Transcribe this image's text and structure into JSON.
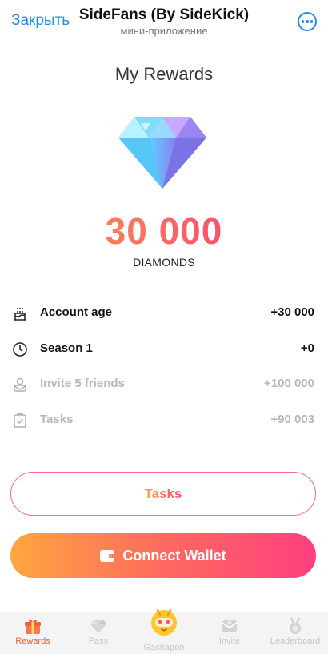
{
  "topbar": {
    "close_label": "Закрыть",
    "title": "SideFans (By SideKick)",
    "subtitle": "мини-приложение",
    "more_icon": "more-circle-icon"
  },
  "page": {
    "title": "My Rewards",
    "amount": "30 000",
    "amount_unit": "DIAMONDS"
  },
  "rewards": [
    {
      "icon": "cake-icon",
      "label": "Account age",
      "value": "+30 000",
      "state": "active"
    },
    {
      "icon": "clock-icon",
      "label": "Season 1",
      "value": "+0",
      "state": "active"
    },
    {
      "icon": "invite-icon",
      "label": "Invite 5 friends",
      "value": "+100 000",
      "state": "dimmed"
    },
    {
      "icon": "clipboard-check-icon",
      "label": "Tasks",
      "value": "+90 003",
      "state": "dimmed"
    }
  ],
  "buttons": {
    "tasks_label": "Tasks",
    "wallet_label": "Connect Wallet"
  },
  "tabbar": {
    "tabs": [
      {
        "icon": "gift-icon",
        "label": "Rewards",
        "active": true
      },
      {
        "icon": "diamond-tab-icon",
        "label": "Pass",
        "active": false
      },
      {
        "icon": "gachapon-icon",
        "label": "Gachapon",
        "active": false
      },
      {
        "icon": "invite-tab-icon",
        "label": "Invite",
        "active": false
      },
      {
        "icon": "medal-icon",
        "label": "Leaderboard",
        "active": false
      }
    ]
  },
  "colors": {
    "link_blue": "#1e8ef0",
    "accent_orange": "#ffa63f",
    "accent_pink": "#ff3f7f",
    "active_tab": "#f0632e"
  }
}
